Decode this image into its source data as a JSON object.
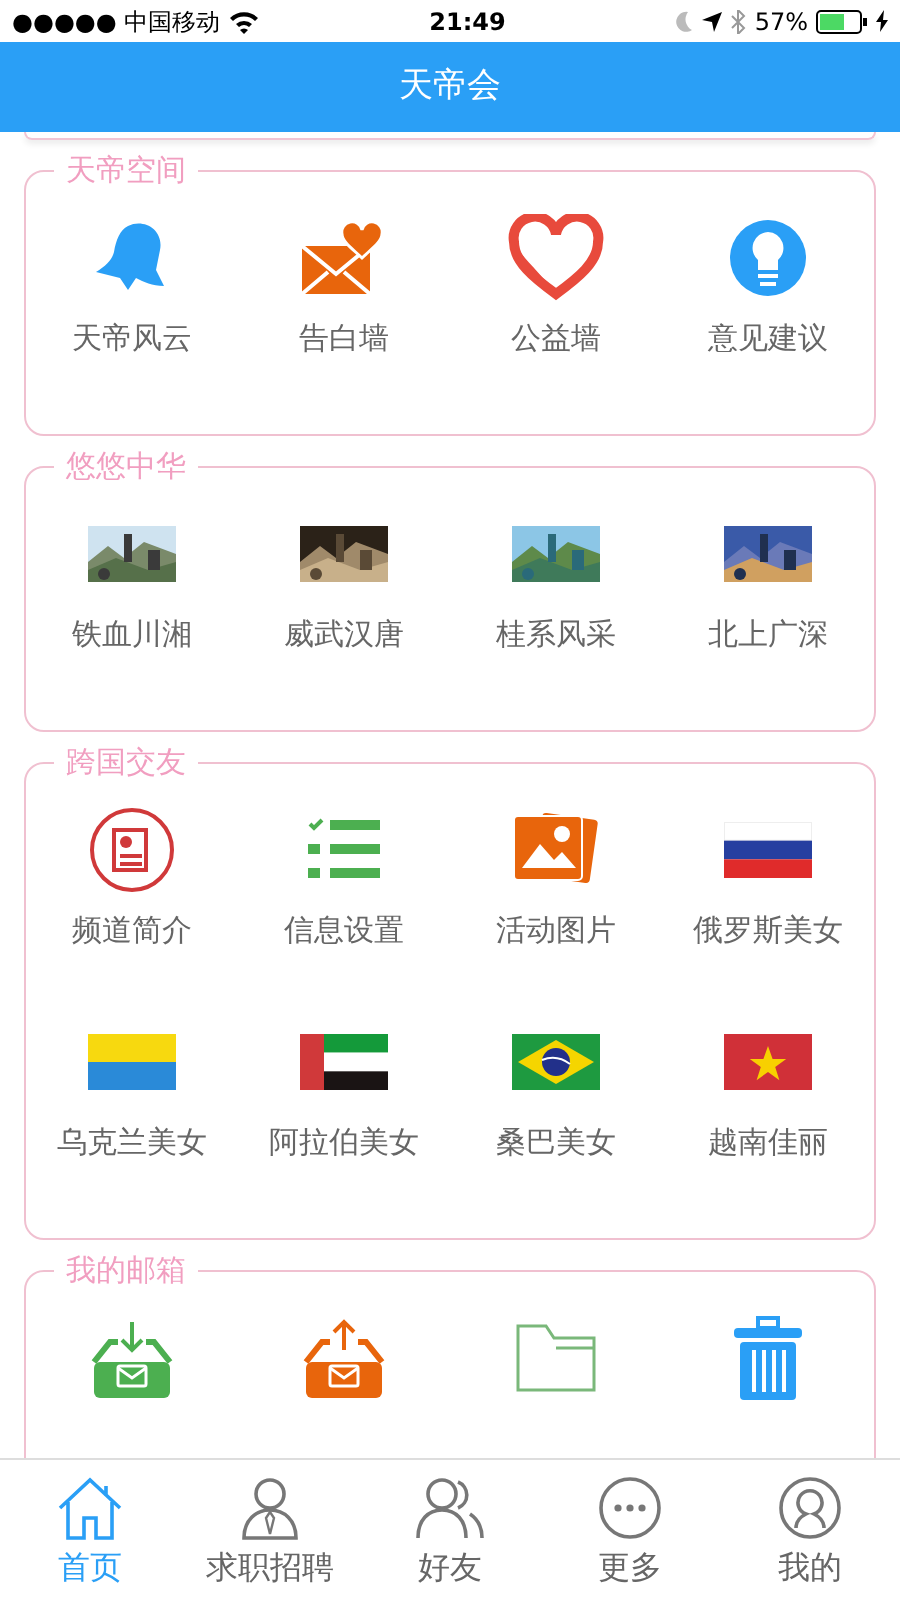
{
  "status_bar": {
    "carrier": "●●●●● 中国移动",
    "time": "21:49",
    "battery": "57%"
  },
  "nav_bar": {
    "title": "天帝会"
  },
  "sections": [
    {
      "title": "天帝空间",
      "items": [
        {
          "kind": "icon",
          "label": "天帝风云"
        },
        {
          "kind": "icon",
          "label": "告白墙"
        },
        {
          "kind": "icon",
          "label": "公益墙"
        },
        {
          "kind": "icon",
          "label": "意见建议"
        }
      ]
    },
    {
      "title": "悠悠中华",
      "items": [
        {
          "kind": "picture",
          "label": "铁血川湘"
        },
        {
          "kind": "picture",
          "label": "威武汉唐"
        },
        {
          "kind": "picture",
          "label": "桂系风采"
        },
        {
          "kind": "picture",
          "label": "北上广深"
        }
      ]
    },
    {
      "title": "跨国交友",
      "items": [
        {
          "kind": "icon",
          "label": "频道简介"
        },
        {
          "kind": "icon",
          "label": "信息设置"
        },
        {
          "kind": "icon",
          "label": "活动图片"
        },
        {
          "kind": "flag",
          "label": "俄罗斯美女"
        },
        {
          "kind": "flag",
          "label": "乌克兰美女"
        },
        {
          "kind": "flag",
          "label": "阿拉伯美女"
        },
        {
          "kind": "flag",
          "label": "桑巴美女"
        },
        {
          "kind": "flag",
          "label": "越南佳丽"
        }
      ]
    },
    {
      "title": "我的邮箱",
      "items": [
        {
          "kind": "icon"
        },
        {
          "kind": "icon"
        },
        {
          "kind": "icon"
        },
        {
          "kind": "icon"
        }
      ]
    }
  ],
  "tab_bar": [
    {
      "label": "首页",
      "selected": true
    },
    {
      "label": "求职招聘",
      "selected": false
    },
    {
      "label": "好友",
      "selected": false
    },
    {
      "label": "更多",
      "selected": false
    },
    {
      "label": "我的",
      "selected": false
    }
  ]
}
